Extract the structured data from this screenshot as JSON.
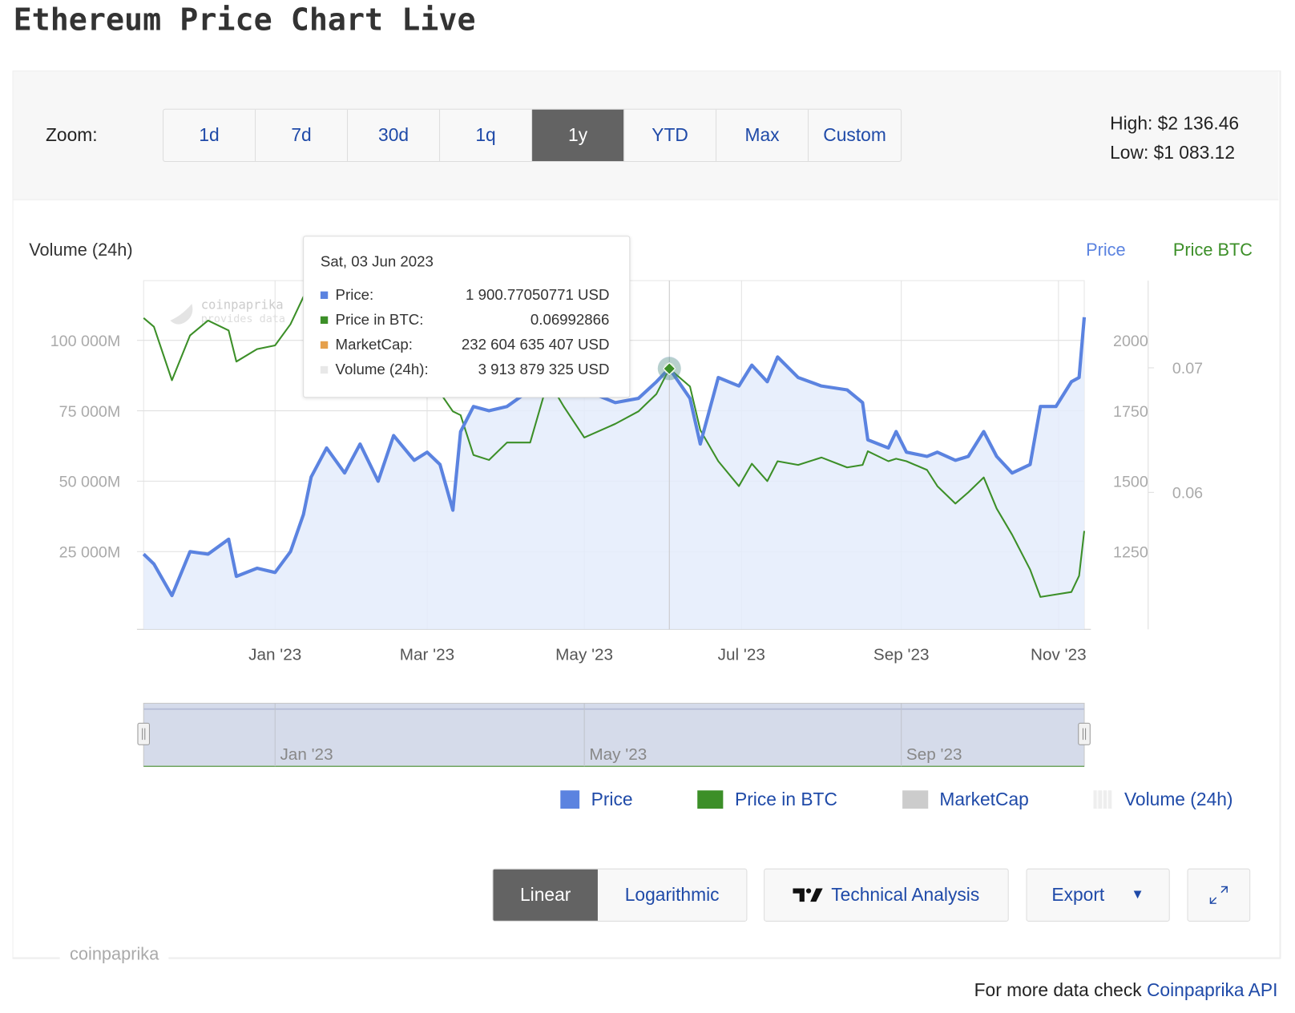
{
  "page": {
    "title": "Ethereum Price Chart Live"
  },
  "toolbar": {
    "zoom_label": "Zoom:",
    "zoom_buttons": [
      "1d",
      "7d",
      "30d",
      "1q",
      "1y",
      "YTD",
      "Max",
      "Custom"
    ],
    "active_zoom": "1y",
    "high": "High: $2 136.46",
    "low": "Low: $1 083.12"
  },
  "tooltip": {
    "date": "Sat, 03 Jun 2023",
    "rows": [
      {
        "label": "Price:",
        "value": "1 900.77050771 USD",
        "color": "#5b83e0"
      },
      {
        "label": "Price in BTC:",
        "value": "0.06992866",
        "color": "#3c8f28"
      },
      {
        "label": "MarketCap:",
        "value": "232 604 635 407 USD",
        "color": "#e5a04c"
      },
      {
        "label": "Volume (24h):",
        "value": "3 913 879 325 USD",
        "color": "#e8e8e8"
      }
    ]
  },
  "legend": [
    {
      "label": "Price",
      "color": "#5b83e0"
    },
    {
      "label": "Price in BTC",
      "color": "#3c8f28"
    },
    {
      "label": "MarketCap",
      "color": "#cccccc"
    },
    {
      "label": "Volume (24h)",
      "color": "#eeeeee"
    }
  ],
  "controls": {
    "linear": "Linear",
    "logarithmic": "Logarithmic",
    "active_scale": "Linear",
    "technical_analysis": "Technical Analysis",
    "export": "Export",
    "export_icon": "triangle-down-icon",
    "fullscreen_icon": "expand-icon",
    "ta_icon": "tradingview-logo-icon"
  },
  "brand_label": "coinpaprika",
  "watermark": "coinpaprika provides data",
  "footer": {
    "text": "For more data check ",
    "link": "Coinpaprika API"
  },
  "chart_data": {
    "type": "line",
    "left_axis_title": "Volume (24h)",
    "right_axis_titles": [
      "Price",
      "Price BTC"
    ],
    "x_ticks": [
      "Jan '23",
      "Mar '23",
      "May '23",
      "Jul '23",
      "Sep '23",
      "Nov '23"
    ],
    "navigator_ticks": [
      "Jan '23",
      "May '23",
      "Sep '23"
    ],
    "x_range": [
      "2022-11-11",
      "2023-11-11"
    ],
    "volume_ticks": [
      "25 000M",
      "50 000M",
      "75 000M",
      "100 000M"
    ],
    "price_ticks": [
      "1250",
      "1500",
      "1750",
      "2000"
    ],
    "btc_ticks": [
      "0.06",
      "0.07"
    ],
    "price_range": [
      974,
      2212
    ],
    "btc_range": [
      0.049,
      0.077
    ],
    "grid": true,
    "highlight_date": "2023-06-03",
    "series": [
      {
        "name": "Price",
        "axis": "price",
        "color": "#5b83e0",
        "points": [
          [
            "2022-11-11",
            1241
          ],
          [
            "2022-11-15",
            1206
          ],
          [
            "2022-11-22",
            1094
          ],
          [
            "2022-11-29",
            1250
          ],
          [
            "2022-12-06",
            1241
          ],
          [
            "2022-12-14",
            1294
          ],
          [
            "2022-12-17",
            1162
          ],
          [
            "2022-12-25",
            1191
          ],
          [
            "2023-01-01",
            1176
          ],
          [
            "2023-01-07",
            1250
          ],
          [
            "2023-01-12",
            1382
          ],
          [
            "2023-01-15",
            1515
          ],
          [
            "2023-01-21",
            1618
          ],
          [
            "2023-01-28",
            1529
          ],
          [
            "2023-02-03",
            1632
          ],
          [
            "2023-02-10",
            1500
          ],
          [
            "2023-02-16",
            1662
          ],
          [
            "2023-02-24",
            1574
          ],
          [
            "2023-03-01",
            1603
          ],
          [
            "2023-03-06",
            1559
          ],
          [
            "2023-03-11",
            1397
          ],
          [
            "2023-03-14",
            1676
          ],
          [
            "2023-03-19",
            1765
          ],
          [
            "2023-03-25",
            1750
          ],
          [
            "2023-04-01",
            1765
          ],
          [
            "2023-04-10",
            1824
          ],
          [
            "2023-04-17",
            1868
          ],
          [
            "2023-04-23",
            1853
          ],
          [
            "2023-05-01",
            1824
          ],
          [
            "2023-05-13",
            1779
          ],
          [
            "2023-05-22",
            1794
          ],
          [
            "2023-05-29",
            1853
          ],
          [
            "2023-06-03",
            1900.77
          ],
          [
            "2023-06-11",
            1794
          ],
          [
            "2023-06-15",
            1632
          ],
          [
            "2023-06-22",
            1868
          ],
          [
            "2023-06-30",
            1838
          ],
          [
            "2023-07-05",
            1912
          ],
          [
            "2023-07-11",
            1853
          ],
          [
            "2023-07-15",
            1941
          ],
          [
            "2023-07-23",
            1868
          ],
          [
            "2023-08-01",
            1838
          ],
          [
            "2023-08-11",
            1824
          ],
          [
            "2023-08-17",
            1779
          ],
          [
            "2023-08-19",
            1647
          ],
          [
            "2023-08-27",
            1618
          ],
          [
            "2023-08-30",
            1676
          ],
          [
            "2023-09-03",
            1603
          ],
          [
            "2023-09-11",
            1588
          ],
          [
            "2023-09-15",
            1603
          ],
          [
            "2023-09-22",
            1574
          ],
          [
            "2023-09-27",
            1588
          ],
          [
            "2023-10-03",
            1676
          ],
          [
            "2023-10-08",
            1588
          ],
          [
            "2023-10-14",
            1529
          ],
          [
            "2023-10-21",
            1559
          ],
          [
            "2023-10-25",
            1765
          ],
          [
            "2023-10-31",
            1765
          ],
          [
            "2023-11-06",
            1853
          ],
          [
            "2023-11-09",
            1868
          ],
          [
            "2023-11-11",
            2082
          ]
        ]
      },
      {
        "name": "Price in BTC",
        "axis": "btc",
        "color": "#3c8f28",
        "points": [
          [
            "2022-11-11",
            0.074
          ],
          [
            "2022-11-15",
            0.0733
          ],
          [
            "2022-11-22",
            0.069
          ],
          [
            "2022-11-29",
            0.0726
          ],
          [
            "2022-12-06",
            0.0738
          ],
          [
            "2022-12-14",
            0.073
          ],
          [
            "2022-12-17",
            0.0705
          ],
          [
            "2022-12-25",
            0.0715
          ],
          [
            "2023-01-01",
            0.0718
          ],
          [
            "2023-01-07",
            0.0735
          ],
          [
            "2023-01-12",
            0.0757
          ],
          [
            "2023-01-15",
            0.0745
          ],
          [
            "2023-01-21",
            0.072
          ],
          [
            "2023-01-28",
            0.07
          ],
          [
            "2023-02-03",
            0.0695
          ],
          [
            "2023-02-10",
            0.069
          ],
          [
            "2023-02-16",
            0.0685
          ],
          [
            "2023-02-24",
            0.069
          ],
          [
            "2023-03-01",
            0.069
          ],
          [
            "2023-03-06",
            0.068
          ],
          [
            "2023-03-11",
            0.0665
          ],
          [
            "2023-03-14",
            0.0662
          ],
          [
            "2023-03-19",
            0.063
          ],
          [
            "2023-03-25",
            0.0626
          ],
          [
            "2023-04-01",
            0.064
          ],
          [
            "2023-04-10",
            0.064
          ],
          [
            "2023-04-17",
            0.069
          ],
          [
            "2023-04-23",
            0.0669
          ],
          [
            "2023-05-01",
            0.0644
          ],
          [
            "2023-05-13",
            0.0655
          ],
          [
            "2023-05-22",
            0.0665
          ],
          [
            "2023-05-29",
            0.0679
          ],
          [
            "2023-06-03",
            0.06992866
          ],
          [
            "2023-06-11",
            0.0685
          ],
          [
            "2023-06-15",
            0.065
          ],
          [
            "2023-06-22",
            0.0625
          ],
          [
            "2023-06-30",
            0.0605
          ],
          [
            "2023-07-05",
            0.0623
          ],
          [
            "2023-07-11",
            0.0609
          ],
          [
            "2023-07-15",
            0.0625
          ],
          [
            "2023-07-23",
            0.0622
          ],
          [
            "2023-08-01",
            0.0628
          ],
          [
            "2023-08-11",
            0.062
          ],
          [
            "2023-08-17",
            0.0622
          ],
          [
            "2023-08-19",
            0.0633
          ],
          [
            "2023-08-27",
            0.0625
          ],
          [
            "2023-08-30",
            0.0627
          ],
          [
            "2023-09-03",
            0.0625
          ],
          [
            "2023-09-11",
            0.0618
          ],
          [
            "2023-09-15",
            0.0605
          ],
          [
            "2023-09-22",
            0.0591
          ],
          [
            "2023-09-27",
            0.06
          ],
          [
            "2023-10-03",
            0.0612
          ],
          [
            "2023-10-08",
            0.0587
          ],
          [
            "2023-10-14",
            0.0566
          ],
          [
            "2023-10-21",
            0.0538
          ],
          [
            "2023-10-25",
            0.0516
          ],
          [
            "2023-10-31",
            0.0518
          ],
          [
            "2023-11-06",
            0.052
          ],
          [
            "2023-11-09",
            0.0533
          ],
          [
            "2023-11-11",
            0.0569
          ]
        ]
      }
    ]
  }
}
